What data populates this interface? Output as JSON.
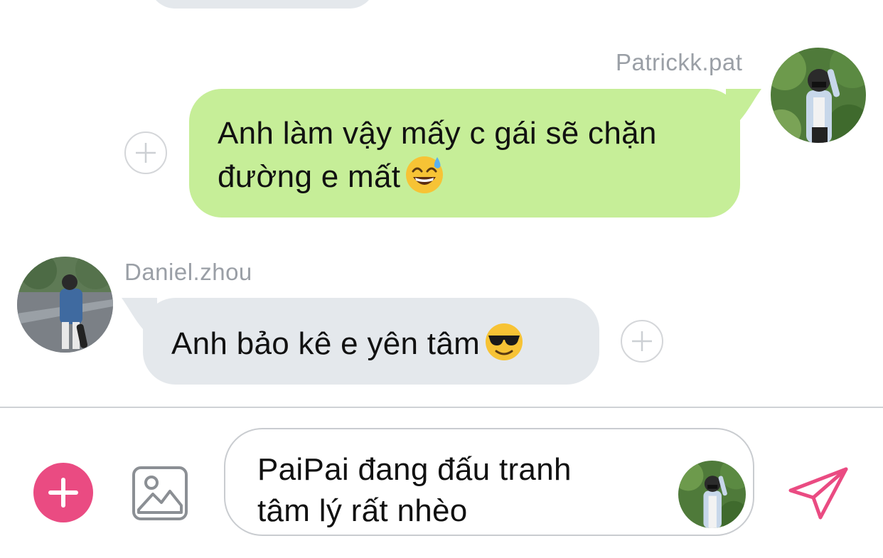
{
  "thread": {
    "messages": [
      {
        "sender": "Patrickk.pat",
        "direction": "outgoing",
        "line1": "Anh làm vậy mấy c gái sẽ chặn",
        "line2": "đường e mất",
        "emoji": "grinning-sweat-emoji",
        "bubble_color": "#c6ee98"
      },
      {
        "sender": "Daniel.zhou",
        "direction": "incoming",
        "text": "Anh bảo kê e yên tâm",
        "emoji": "sunglasses-emoji",
        "bubble_color": "#e4e8ec"
      }
    ]
  },
  "composer": {
    "line1": "PaiPai đang đấu tranh",
    "line2": "tâm lý rất nhèo",
    "accent_color": "#ea4b82"
  }
}
